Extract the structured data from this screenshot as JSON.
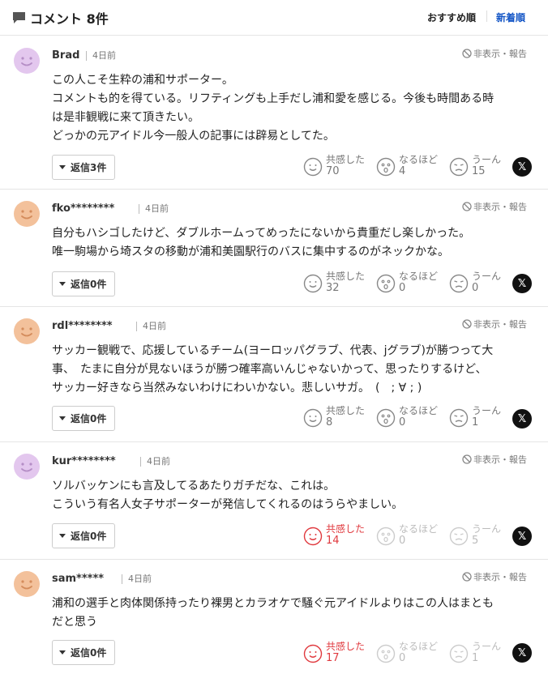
{
  "header": {
    "title": "コメント 8件",
    "sort_recommended": "おすすめ順",
    "sort_newest": "新着順",
    "active_color": "#1456c6"
  },
  "labels": {
    "hide_report": "非表示・報告",
    "reaction_empathy": "共感した",
    "reaction_insight": "なるほど",
    "reaction_hmm": "うーん",
    "x_share": "𝕏"
  },
  "comments": [
    {
      "user": "Brad",
      "time": "4日前",
      "avatar_color": "#e3c7ee",
      "lines": [
        "この人こそ生粋の浦和サポーター。",
        "コメントも的を得ている。リフティングも上手だし浦和愛を感じる。今後も時間ある時",
        "は是非観戦に来て頂きたい。",
        "どっかの元アイドル今一般人の記事には辟易としてた。"
      ],
      "reply_label": "返信3件",
      "empathy": "70",
      "insight": "4",
      "hmm": "15"
    },
    {
      "user": "fko********",
      "time": "4日前",
      "avatar_color": "#f3c19b",
      "lines": [
        "自分もハシゴしたけど、ダブルホームってめったにないから貴重だし楽しかった。",
        "唯一駒場から埼スタの移動が浦和美園駅行のバスに集中するのがネックかな。"
      ],
      "reply_label": "返信0件",
      "empathy": "32",
      "insight": "0",
      "hmm": "0"
    },
    {
      "user": "rdl********",
      "time": "4日前",
      "avatar_color": "#f3c19b",
      "lines": [
        "サッカー観戦で、応援しているチーム(ヨーロッパグラブ、代表、jグラブ)が勝つって大",
        "事、　たまに自分が見ないほうが勝つ確率高いんじゃないかって、思ったりするけど、",
        "サッカー好きなら当然みないわけにわいかない。悲しいサガ。　(　; ∀ ; )"
      ],
      "reply_label": "返信0件",
      "empathy": "8",
      "insight": "0",
      "hmm": "1"
    },
    {
      "user": "kur********",
      "time": "4日前",
      "avatar_color": "#e3c7ee",
      "lines": [
        "ソルバッケンにも言及してるあたりガチだな、これは。",
        "こういう有名人女子サポーターが発信してくれるのはうらやましい。"
      ],
      "reply_label": "返信0件",
      "empathy": "14",
      "insight": "0",
      "hmm": "5"
    },
    {
      "user": "sam*****",
      "time": "4日前",
      "avatar_color": "#f3c19b",
      "lines": [
        "浦和の選手と肉体関係持ったり裸男とカラオケで騒ぐ元アイドルよりはこの人はまとも",
        "だと思う"
      ],
      "reply_label": "返信0件",
      "empathy": "17",
      "insight": "0",
      "hmm": "1"
    }
  ]
}
